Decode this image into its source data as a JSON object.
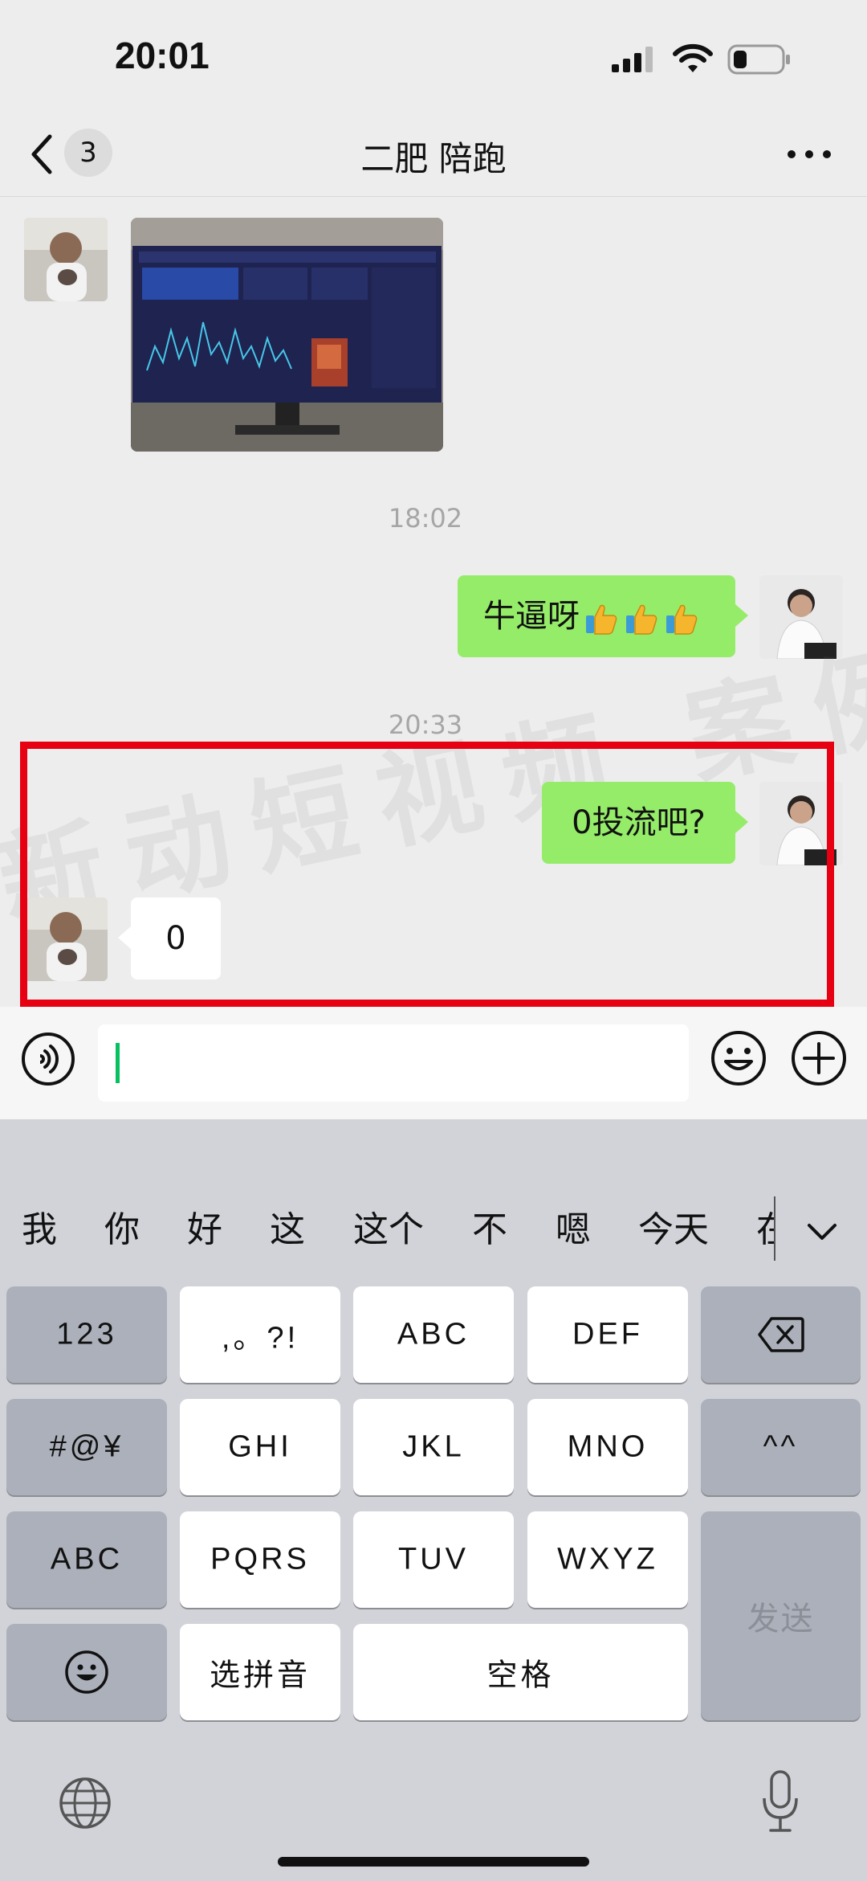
{
  "status_bar": {
    "time": "20:01"
  },
  "nav": {
    "unread_count": "3",
    "title": "二肥 陪跑"
  },
  "messages": {
    "timestamp_1": "18:02",
    "msg_1": "牛逼呀",
    "timestamp_2": "20:33",
    "msg_2": "0投流吧?",
    "msg_3": "0"
  },
  "watermark": "新动短视频 案例",
  "keyboard": {
    "candidates": [
      "我",
      "你",
      "好",
      "这",
      "这个",
      "不",
      "嗯",
      "今天",
      "在"
    ],
    "keys": {
      "numbers": "123",
      "punct": ",。?!",
      "abc_top": "ABC",
      "def": "DEF",
      "symbols": "#@¥",
      "ghi": "GHI",
      "jkl": "JKL",
      "mno": "MNO",
      "face": "^^",
      "abc_left": "ABC",
      "pqrs": "PQRS",
      "tuv": "TUV",
      "wxyz": "WXYZ",
      "send": "发送",
      "pinyin": "选拼音",
      "space": "空格"
    }
  },
  "colors": {
    "green_bubble": "#95ec69",
    "highlight_border": "#e60012",
    "cursor": "#07c160"
  },
  "icons": [
    "back-icon",
    "more-icon",
    "voice-icon",
    "emoji-icon",
    "plus-icon",
    "delete-icon",
    "globe-icon",
    "mic-icon",
    "chevron-down-icon",
    "thumbs-up-icon"
  ]
}
